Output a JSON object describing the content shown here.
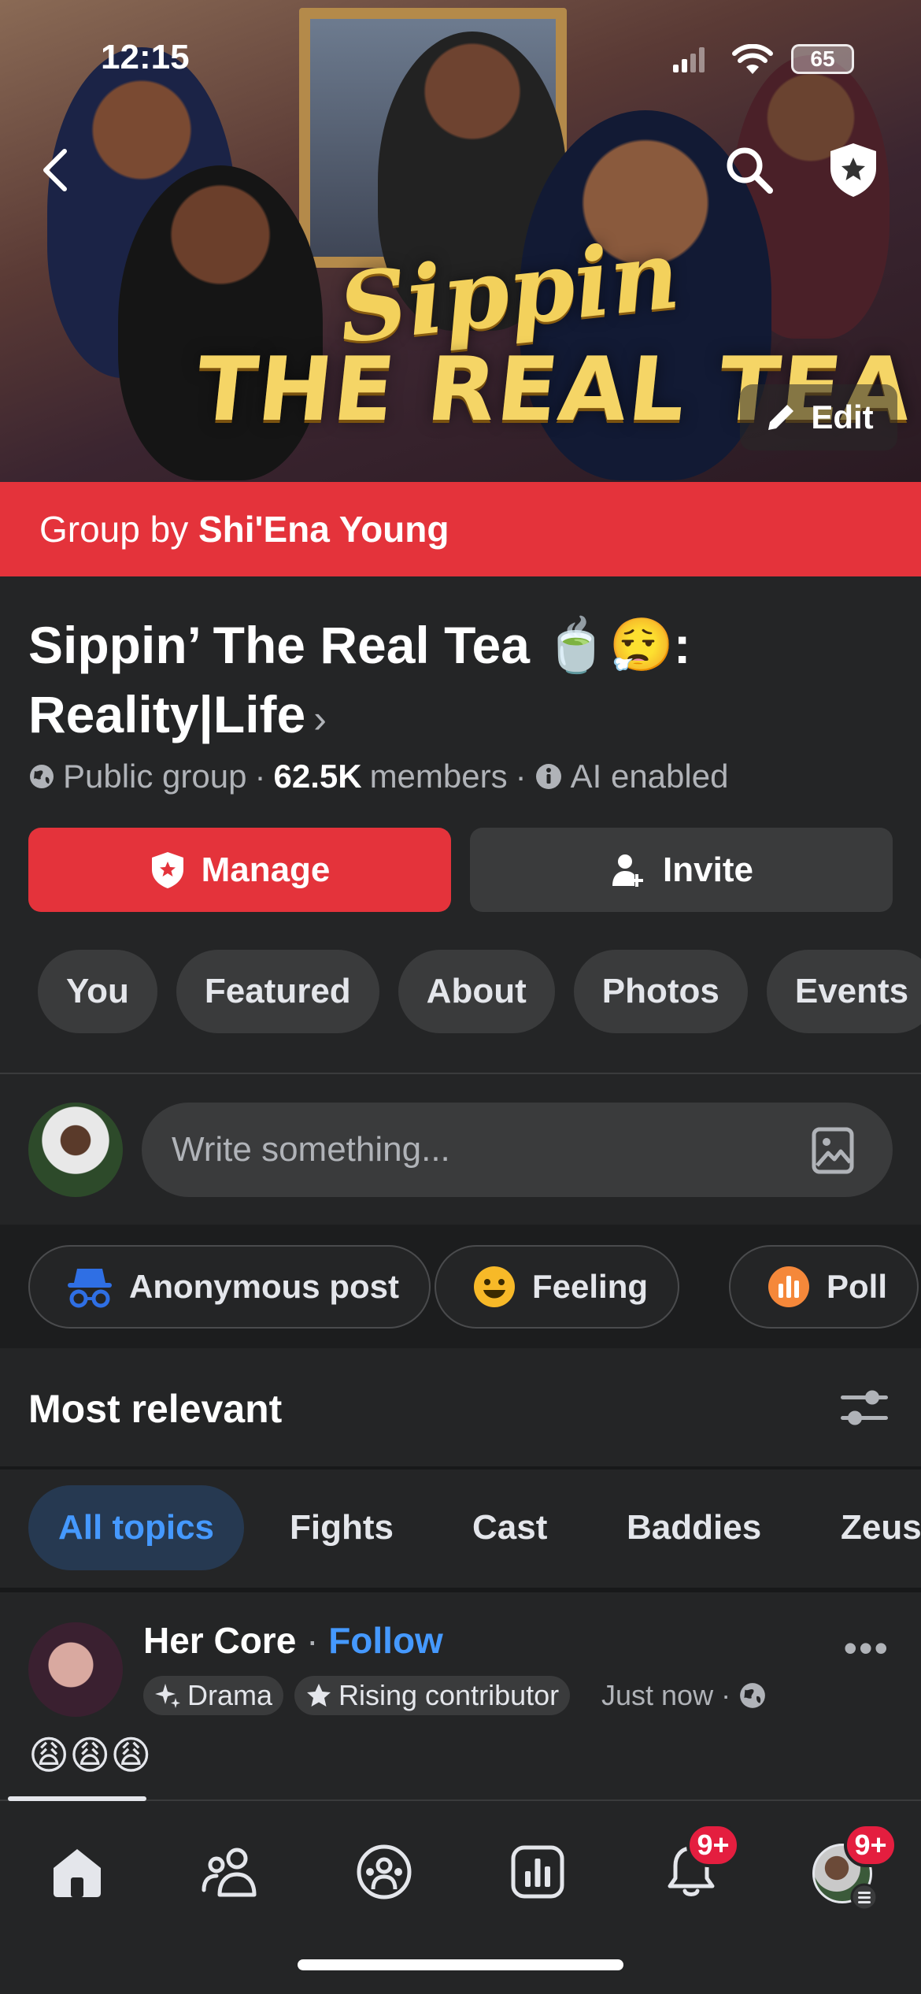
{
  "status_bar": {
    "time": "12:15",
    "battery": "65"
  },
  "cover": {
    "title_line1": "Sippin",
    "title_line2": "THE REAL TEA",
    "edit_label": "Edit"
  },
  "group_by": {
    "prefix": "Group by",
    "owner": "Shi'Ena Young"
  },
  "group": {
    "name": "Sippin’ The Real Tea 🍵😮‍💨: Reality|Life",
    "chevron": "›",
    "privacy": "Public group",
    "members_count": "62.5K",
    "members_label": "members",
    "ai_label": "AI enabled"
  },
  "actions": {
    "manage_label": "Manage",
    "invite_label": "Invite"
  },
  "tabs": [
    "You",
    "Featured",
    "About",
    "Photos",
    "Events"
  ],
  "composer": {
    "placeholder": "Write something..."
  },
  "post_types": [
    "Anonymous post",
    "Feeling",
    "Poll"
  ],
  "sort": {
    "label": "Most relevant"
  },
  "topics": [
    "All topics",
    "Fights",
    "Cast",
    "Baddies",
    "Zeus"
  ],
  "post": {
    "author": "Her Core",
    "follow_label": "Follow",
    "badge1": "Drama",
    "badge2": "Rising contributor",
    "time": "Just now ·",
    "content": "😩😩😩",
    "more": "•••"
  },
  "bottom_nav": {
    "notifications_badge": "9+",
    "profile_badge": "9+"
  },
  "colors": {
    "accent_red": "#e4333b",
    "link_blue": "#4599ff",
    "background": "#242526"
  }
}
